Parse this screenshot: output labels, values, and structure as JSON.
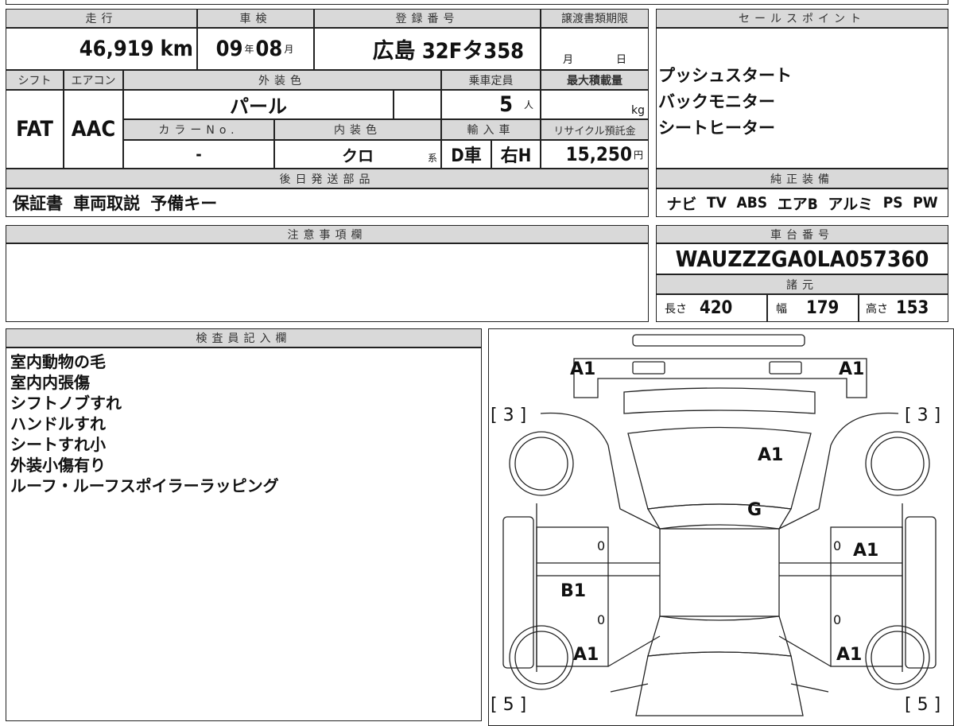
{
  "main": {
    "mileage_label": "走行",
    "mileage": "46,919",
    "mileage_unit": "km",
    "shaken_label": "車検",
    "shaken_year": "09",
    "year_unit": "年",
    "shaken_month": "08",
    "month_unit": "月",
    "reg_label": "登録番号",
    "reg": "広島 32Fタ358",
    "transfer_label": "譲渡書類期限",
    "transfer_month": "月",
    "transfer_day": "日",
    "shift_label": "シフト",
    "shift": "FAT",
    "ac_label": "エアコン",
    "ac": "AAC",
    "ext_color_label": "外装色",
    "ext_color": "パール",
    "capacity_label": "乗車定員",
    "capacity": "5",
    "capacity_unit": "人",
    "max_load_label": "最大積載量",
    "max_load_unit": "kg",
    "color_no_label": "カラーNo.",
    "color_no": "-",
    "int_color_label": "内装色",
    "int_color": "クロ",
    "int_color_suffix": "系",
    "import_label": "輸入車",
    "import_type": "D車",
    "steering": "右H",
    "recycle_label": "リサイクル預託金",
    "recycle": "15,250",
    "recycle_unit": "円",
    "later_parts_label": "後日発送部品",
    "later_parts": "保証書  車両取説  予備キー"
  },
  "sales": {
    "label": "セールスポイント",
    "items": [
      "プッシュスタート",
      "バックモニター",
      "シートヒーター"
    ]
  },
  "equipment": {
    "label": "純正装備",
    "items": [
      "ナビ",
      "TV",
      "ABS",
      "エアB",
      "アルミ",
      "PS",
      "PW"
    ]
  },
  "notes": {
    "label": "注意事項欄"
  },
  "chassis": {
    "label": "車台番号",
    "vin": "WAUZZZGA0LA057360",
    "spec_label": "諸元",
    "length_label": "長さ",
    "length": "420",
    "width_label": "幅",
    "width": "179",
    "height_label": "高さ",
    "height": "153"
  },
  "inspector": {
    "label": "検査員記入欄",
    "items": [
      "室内動物の毛",
      "室内内張傷",
      "シフトノブすれ",
      "ハンドルすれ",
      "シートすれ小",
      "外装小傷有り",
      "ルーフ・ルーフスポイラーラッピング"
    ]
  },
  "diagram": {
    "front_left": "A1",
    "front_right": "A1",
    "hood": "A1",
    "windshield": "G",
    "right_front_door": "A1",
    "left_rear_door": "B1",
    "left_rear_fender": "A1",
    "right_rear_fender": "A1",
    "tire_front_left": "[ 3 ]",
    "tire_front_right": "[ 3 ]",
    "tire_rear_left": "[ 5 ]",
    "tire_rear_right": "[ 5 ]",
    "door_marks": [
      "0",
      "0",
      "0",
      "0"
    ]
  }
}
